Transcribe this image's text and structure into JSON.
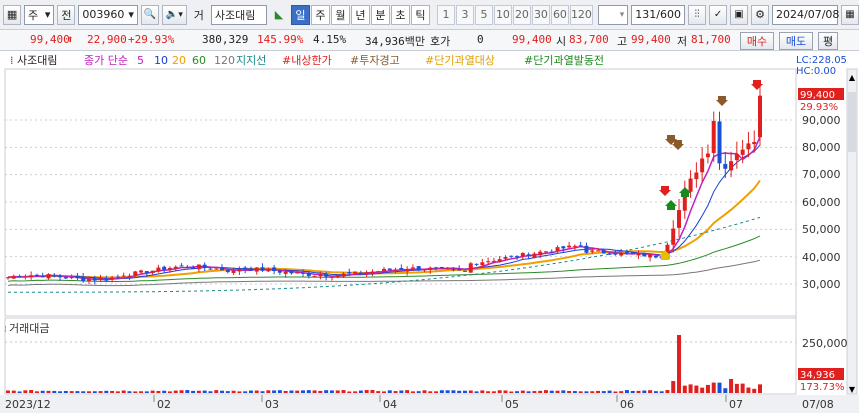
{
  "toolbar": {
    "market": "주",
    "market_arrow": "▾",
    "prefix": "전",
    "code": "003960",
    "code_arrow": "▾",
    "search": "🔍",
    "speaker": "🔈",
    "speaker_arrow": "▾",
    "type": "거",
    "name": "사조대림",
    "periods": [
      "일",
      "주",
      "월",
      "년",
      "분",
      "초",
      "틱"
    ],
    "active_period": "일",
    "numbers": [
      "1",
      "3",
      "5",
      "10",
      "20",
      "30",
      "60",
      "120"
    ],
    "count": "131/600",
    "date": "2024/07/08"
  },
  "quote": {
    "price": "99,400",
    "change": "22,900",
    "change_pct": "+29.93%",
    "volume": "380,329",
    "vol_ratio": "145.99%",
    "turnover": "4.15%",
    "amount": "34,936백만",
    "hoga_label": "호가",
    "hoga_value": "0",
    "hoga_price": "99,400",
    "open_label": "시",
    "open": "83,700",
    "high_label": "고",
    "high": "99,400",
    "low_label": "저",
    "low": "81,700",
    "buy": "매수",
    "sell": "매도",
    "avg": "평"
  },
  "legend": {
    "name": "사조대림",
    "ma_label": "종가 단순",
    "ma": [
      "5",
      "10",
      "20",
      "60",
      "120"
    ],
    "ma_colors": [
      "#c020c0",
      "#1a3fd6",
      "#f0a000",
      "#2a8a2a",
      "#777777"
    ],
    "support": "지지선",
    "tags": [
      "#내상한가",
      "#투자경고",
      "#단기과열대상",
      "#단기과열발동전"
    ],
    "tag_colors": [
      "#e0201f",
      "#8b5a2b",
      "#e0a000",
      "#1a8a1a"
    ],
    "lc": "LC:228.05",
    "hc": "HC:0.00"
  },
  "price_axis": [
    "90,000",
    "80,000",
    "70,000",
    "60,000",
    "50,000",
    "40,000",
    "30,000"
  ],
  "price_tag": "99,400",
  "price_tag_pct": "29.93%",
  "volume_panel": {
    "title": "거래대금",
    "axis": [
      "250,000"
    ],
    "tag": "34,936",
    "tag_pct": "173.73%"
  },
  "x_axis": [
    "2023/12",
    "02",
    "03",
    "04",
    "05",
    "06",
    "07",
    "07/08"
  ],
  "colors": {
    "up": "#e0201f",
    "down": "#1a4fd6",
    "accent": "#3a6fc8"
  }
}
